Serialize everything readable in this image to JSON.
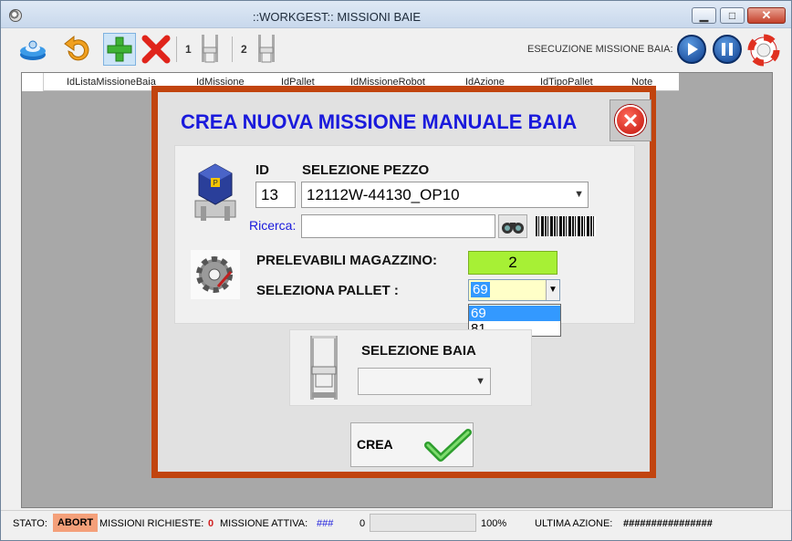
{
  "window": {
    "title": "::WORKGEST::   MISSIONI BAIE",
    "min_glyph": "▁",
    "max_glyph": "□",
    "close_glyph": "✕"
  },
  "toolbar": {
    "bay1_label": "1",
    "bay2_label": "2",
    "exec_label": "ESECUZIONE MISSIONE BAIA:"
  },
  "grid": {
    "columns": [
      "IdListaMissioneBaia",
      "IdMissione",
      "IdPallet",
      "IdMissioneRobot",
      "IdAzione",
      "IdTipoPallet",
      "Note"
    ]
  },
  "modal": {
    "title": "CREA NUOVA MISSIONE MANUALE BAIA",
    "id_label": "ID",
    "id_value": "13",
    "piece_label": "SELEZIONE PEZZO",
    "piece_value": "12112W-44130_OP10",
    "search_label": "Ricerca:",
    "search_value": "",
    "prelev_label": "PRELEVABILI MAGAZZINO:",
    "prelev_value": "2",
    "pallet_label": "SELEZIONA PALLET :",
    "pallet_value": "69",
    "pallet_options": [
      "69",
      "81"
    ],
    "bay_label": "SELEZIONE BAIA",
    "bay_value": "",
    "create_label": "CREA"
  },
  "status": {
    "stato_label": "STATO:",
    "stato_value": "ABORT",
    "richieste_label": "MISSIONI RICHIESTE:",
    "richieste_value": "0",
    "attiva_label": "MISSIONE ATTIVA:",
    "attiva_value": "###",
    "progress_count": "0",
    "progress_percent": "100%",
    "ultima_label": "ULTIMA AZIONE:",
    "ultima_value": "################"
  },
  "colors": {
    "modal_border": "#c1440e",
    "title_blue": "#1a1adc",
    "prelev_green": "#a7f035",
    "abort_bg": "#f4a07a"
  }
}
